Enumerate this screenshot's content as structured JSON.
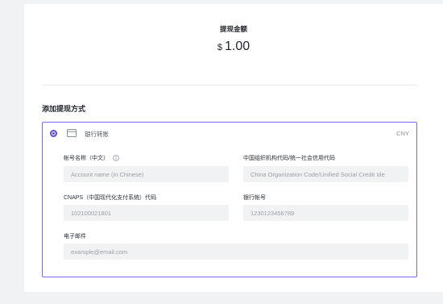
{
  "summary": {
    "title": "提现金额",
    "currency_symbol": "$",
    "amount": "1.00"
  },
  "section": {
    "title": "添加提现方式"
  },
  "method": {
    "icon": "bank-card-icon",
    "label": "银行转账",
    "currency": "CNY",
    "selected": true,
    "accent_color": "#5b4bdb",
    "border_color": "#7b68ee"
  },
  "fields": {
    "account_name": {
      "label": "帐号名称（中文）",
      "placeholder": "Account name (in Chinese)",
      "icon": "info-icon"
    },
    "org_code": {
      "label": "中国组织机构代码/统一社会信用代码",
      "placeholder": "China Organization Code/Unified Social Credit Ide"
    },
    "cnaps": {
      "label": "CNAPS（中国现代化支付系统）代码",
      "placeholder": "102100021801"
    },
    "bank_account": {
      "label": "银行帐号",
      "placeholder": "1230123456789"
    },
    "email": {
      "label": "电子邮件",
      "placeholder": "example@email.com"
    }
  }
}
